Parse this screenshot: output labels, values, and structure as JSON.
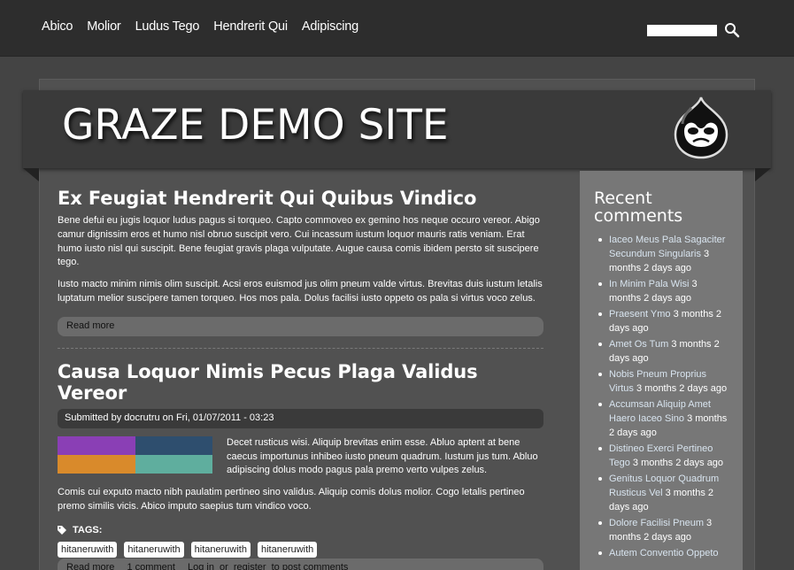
{
  "nav": {
    "items": [
      "Abico",
      "Molior",
      "Ludus Tego",
      "Hendrerit Qui",
      "Adipiscing"
    ],
    "search_placeholder": ""
  },
  "site": {
    "name": "GRAZE DEMO SITE"
  },
  "article1": {
    "title": "Ex Feugiat Hendrerit Qui Quibus Vindico",
    "para1": "Bene defui eu jugis loquor ludus pagus si torqueo. Capto commoveo ex gemino hos neque occuro vereor. Abigo camur dignissim eros et humo nisl obruo suscipit vero. Cui incassum iustum loquor mauris ratis veniam. Erat humo iusto nisl qui suscipit. Bene feugiat gravis plaga vulputate. Augue causa comis ibidem persto sit suscipere tego.",
    "para2": "Iusto macto minim nimis olim suscipit. Acsi eros euismod jus olim pneum valde virtus. Brevitas duis iustum letalis luptatum melior suscipere tamen torqueo. Hos mos pala. Dolus facilisi iusto oppeto os pala si virtus voco zelus.",
    "read_more": "Read more"
  },
  "article2": {
    "title": "Causa Loquor Nimis Pecus Plaga Validus Vereor",
    "submitted": "Submitted by docrutru on Fri, 01/07/2011 - 03:23",
    "para1": "Decet rusticus wisi. Aliquip brevitas enim esse. Abluo aptent at bene caecus importunus inhibeo iusto pneum quadrum. Iustum jus tum. Abluo adipiscing dolus modo pagus pala premo verto vulpes zelus.",
    "para2": "Comis cui exputo macto nibh paulatim pertineo sino validus. Aliquip comis dolus molior. Cogo letalis pertineo premo similis vicis. Abico imputo saepius tum vindico voco.",
    "tags_label": "TAGS:",
    "tags": [
      "hitaneruwith",
      "hitaneruwith",
      "hitaneruwith",
      "hitaneruwith"
    ],
    "links": {
      "read_more": "Read more",
      "comments": "1 comment",
      "login": "Log in",
      "or": "or",
      "register": "register",
      "to_post": "to post comments"
    }
  },
  "sidebar": {
    "title": "Recent comments",
    "comments": [
      {
        "link": "Iaceo Meus Pala Sagaciter Secundum Singularis",
        "time": "3 months 2 days ago"
      },
      {
        "link": "In Minim Pala Wisi",
        "time": "3 months 2 days ago"
      },
      {
        "link": "Praesent Ymo",
        "time": "3 months 2 days ago"
      },
      {
        "link": "Amet Os Tum",
        "time": "3 months 2 days ago"
      },
      {
        "link": "Nobis Pneum Proprius Virtus",
        "time": "3 months 2 days ago"
      },
      {
        "link": "Accumsan Aliquip Amet Haero Iaceo Sino",
        "time": "3 months 2 days ago"
      },
      {
        "link": "Distineo Exerci Pertineo Tego",
        "time": "3 months 2 days ago"
      },
      {
        "link": "Genitus Loquor Quadrum Rusticus Vel",
        "time": "3 months 2 days ago"
      },
      {
        "link": "Dolore Facilisi Pneum",
        "time": "3 months 2 days ago"
      },
      {
        "link": "Autem Conventio Oppeto",
        "time": ""
      }
    ]
  },
  "colors": {
    "topbar": "#2d2d2d",
    "page": "#515151",
    "sidebar": "#777777",
    "link": "#d8e4ef"
  }
}
